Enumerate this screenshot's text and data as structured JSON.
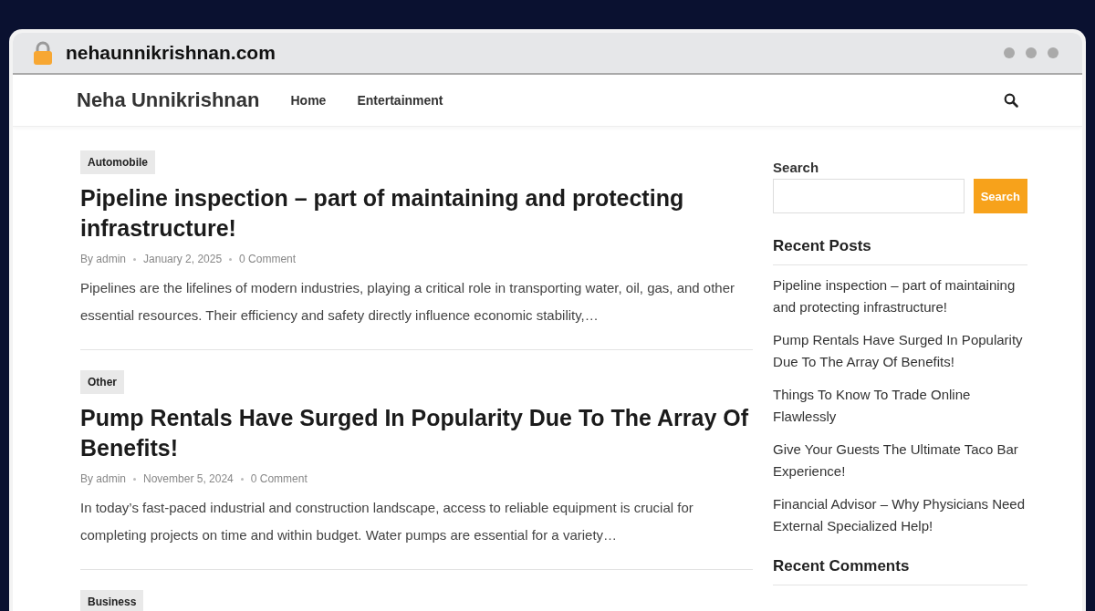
{
  "browser": {
    "address": "nehaunnikrishnan.com"
  },
  "site": {
    "title": "Neha Unnikrishnan",
    "nav": [
      {
        "label": "Home"
      },
      {
        "label": "Entertainment"
      }
    ]
  },
  "posts": [
    {
      "category": "Automobile",
      "title": "Pipeline inspection – part of maintaining and protecting infrastructure!",
      "author": "By admin",
      "date": "January 2, 2025",
      "comments": "0 Comment",
      "excerpt": "Pipelines are the lifelines of modern industries, playing a critical role in transporting water, oil, gas, and other essential resources. Their efficiency and safety directly influence economic stability,…"
    },
    {
      "category": "Other",
      "title": "Pump Rentals Have Surged In Popularity Due To The Array Of Benefits!",
      "author": "By admin",
      "date": "November 5, 2024",
      "comments": "0 Comment",
      "excerpt": "In today’s fast-paced industrial and construction landscape, access to reliable equipment is crucial for completing projects on time and within budget. Water pumps are essential for a variety…"
    },
    {
      "category": "Business"
    }
  ],
  "sidebar": {
    "search_label": "Search",
    "search_button": "Search",
    "recent_posts_heading": "Recent Posts",
    "recent_posts": [
      "Pipeline inspection – part of maintaining and protecting infrastructure!",
      "Pump Rentals Have Surged In Popularity Due To The Array Of Benefits!",
      "Things To Know To Trade Online Flawlessly",
      "Give Your Guests The Ultimate Taco Bar Experience!",
      "Financial Advisor – Why Physicians Need External Specialized Help!"
    ],
    "recent_comments_heading": "Recent Comments"
  }
}
